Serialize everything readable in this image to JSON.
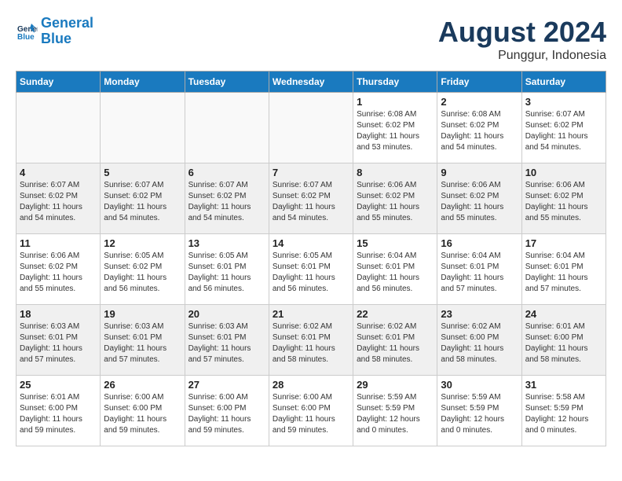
{
  "header": {
    "logo_line1": "General",
    "logo_line2": "Blue",
    "month": "August 2024",
    "location": "Punggur, Indonesia"
  },
  "days_of_week": [
    "Sunday",
    "Monday",
    "Tuesday",
    "Wednesday",
    "Thursday",
    "Friday",
    "Saturday"
  ],
  "weeks": [
    [
      {
        "day": "",
        "info": ""
      },
      {
        "day": "",
        "info": ""
      },
      {
        "day": "",
        "info": ""
      },
      {
        "day": "",
        "info": ""
      },
      {
        "day": "1",
        "info": "Sunrise: 6:08 AM\nSunset: 6:02 PM\nDaylight: 11 hours\nand 53 minutes."
      },
      {
        "day": "2",
        "info": "Sunrise: 6:08 AM\nSunset: 6:02 PM\nDaylight: 11 hours\nand 54 minutes."
      },
      {
        "day": "3",
        "info": "Sunrise: 6:07 AM\nSunset: 6:02 PM\nDaylight: 11 hours\nand 54 minutes."
      }
    ],
    [
      {
        "day": "4",
        "info": "Sunrise: 6:07 AM\nSunset: 6:02 PM\nDaylight: 11 hours\nand 54 minutes."
      },
      {
        "day": "5",
        "info": "Sunrise: 6:07 AM\nSunset: 6:02 PM\nDaylight: 11 hours\nand 54 minutes."
      },
      {
        "day": "6",
        "info": "Sunrise: 6:07 AM\nSunset: 6:02 PM\nDaylight: 11 hours\nand 54 minutes."
      },
      {
        "day": "7",
        "info": "Sunrise: 6:07 AM\nSunset: 6:02 PM\nDaylight: 11 hours\nand 54 minutes."
      },
      {
        "day": "8",
        "info": "Sunrise: 6:06 AM\nSunset: 6:02 PM\nDaylight: 11 hours\nand 55 minutes."
      },
      {
        "day": "9",
        "info": "Sunrise: 6:06 AM\nSunset: 6:02 PM\nDaylight: 11 hours\nand 55 minutes."
      },
      {
        "day": "10",
        "info": "Sunrise: 6:06 AM\nSunset: 6:02 PM\nDaylight: 11 hours\nand 55 minutes."
      }
    ],
    [
      {
        "day": "11",
        "info": "Sunrise: 6:06 AM\nSunset: 6:02 PM\nDaylight: 11 hours\nand 55 minutes."
      },
      {
        "day": "12",
        "info": "Sunrise: 6:05 AM\nSunset: 6:02 PM\nDaylight: 11 hours\nand 56 minutes."
      },
      {
        "day": "13",
        "info": "Sunrise: 6:05 AM\nSunset: 6:01 PM\nDaylight: 11 hours\nand 56 minutes."
      },
      {
        "day": "14",
        "info": "Sunrise: 6:05 AM\nSunset: 6:01 PM\nDaylight: 11 hours\nand 56 minutes."
      },
      {
        "day": "15",
        "info": "Sunrise: 6:04 AM\nSunset: 6:01 PM\nDaylight: 11 hours\nand 56 minutes."
      },
      {
        "day": "16",
        "info": "Sunrise: 6:04 AM\nSunset: 6:01 PM\nDaylight: 11 hours\nand 57 minutes."
      },
      {
        "day": "17",
        "info": "Sunrise: 6:04 AM\nSunset: 6:01 PM\nDaylight: 11 hours\nand 57 minutes."
      }
    ],
    [
      {
        "day": "18",
        "info": "Sunrise: 6:03 AM\nSunset: 6:01 PM\nDaylight: 11 hours\nand 57 minutes."
      },
      {
        "day": "19",
        "info": "Sunrise: 6:03 AM\nSunset: 6:01 PM\nDaylight: 11 hours\nand 57 minutes."
      },
      {
        "day": "20",
        "info": "Sunrise: 6:03 AM\nSunset: 6:01 PM\nDaylight: 11 hours\nand 57 minutes."
      },
      {
        "day": "21",
        "info": "Sunrise: 6:02 AM\nSunset: 6:01 PM\nDaylight: 11 hours\nand 58 minutes."
      },
      {
        "day": "22",
        "info": "Sunrise: 6:02 AM\nSunset: 6:01 PM\nDaylight: 11 hours\nand 58 minutes."
      },
      {
        "day": "23",
        "info": "Sunrise: 6:02 AM\nSunset: 6:00 PM\nDaylight: 11 hours\nand 58 minutes."
      },
      {
        "day": "24",
        "info": "Sunrise: 6:01 AM\nSunset: 6:00 PM\nDaylight: 11 hours\nand 58 minutes."
      }
    ],
    [
      {
        "day": "25",
        "info": "Sunrise: 6:01 AM\nSunset: 6:00 PM\nDaylight: 11 hours\nand 59 minutes."
      },
      {
        "day": "26",
        "info": "Sunrise: 6:00 AM\nSunset: 6:00 PM\nDaylight: 11 hours\nand 59 minutes."
      },
      {
        "day": "27",
        "info": "Sunrise: 6:00 AM\nSunset: 6:00 PM\nDaylight: 11 hours\nand 59 minutes."
      },
      {
        "day": "28",
        "info": "Sunrise: 6:00 AM\nSunset: 6:00 PM\nDaylight: 11 hours\nand 59 minutes."
      },
      {
        "day": "29",
        "info": "Sunrise: 5:59 AM\nSunset: 5:59 PM\nDaylight: 12 hours\nand 0 minutes."
      },
      {
        "day": "30",
        "info": "Sunrise: 5:59 AM\nSunset: 5:59 PM\nDaylight: 12 hours\nand 0 minutes."
      },
      {
        "day": "31",
        "info": "Sunrise: 5:58 AM\nSunset: 5:59 PM\nDaylight: 12 hours\nand 0 minutes."
      }
    ]
  ]
}
